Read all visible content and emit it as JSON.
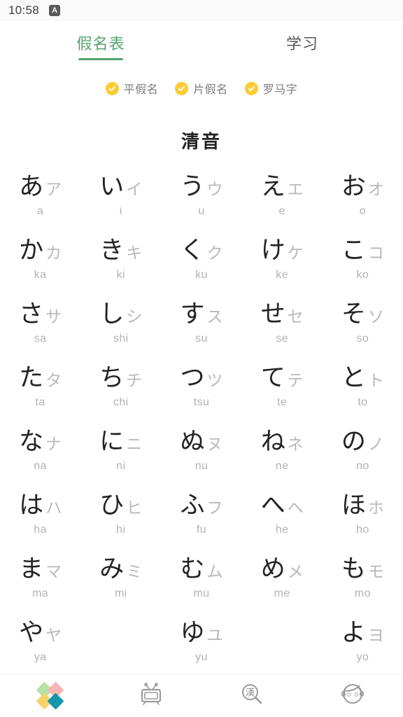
{
  "statusbar": {
    "time": "10:58",
    "ime_badge": "A"
  },
  "tabs": [
    {
      "label": "假名表",
      "active": true,
      "name": "tab-kana-table"
    },
    {
      "label": "学习",
      "active": false,
      "name": "tab-study"
    }
  ],
  "filters": [
    {
      "label": "平假名",
      "checked": true,
      "name": "filter-hiragana"
    },
    {
      "label": "片假名",
      "checked": true,
      "name": "filter-katakana"
    },
    {
      "label": "罗马字",
      "checked": true,
      "name": "filter-romaji"
    }
  ],
  "section": {
    "title": "清音"
  },
  "colors": {
    "accent_green": "#54a36e",
    "check_yellow": "#FCCB33",
    "hiragana": "#232323",
    "katakana": "#b9b9b9",
    "romaji": "#b2b2b2"
  },
  "kana_rows": [
    [
      {
        "hiragana": "あ",
        "katakana": "ア",
        "romaji": "a"
      },
      {
        "hiragana": "い",
        "katakana": "イ",
        "romaji": "i"
      },
      {
        "hiragana": "う",
        "katakana": "ウ",
        "romaji": "u"
      },
      {
        "hiragana": "え",
        "katakana": "エ",
        "romaji": "e"
      },
      {
        "hiragana": "お",
        "katakana": "オ",
        "romaji": "o"
      }
    ],
    [
      {
        "hiragana": "か",
        "katakana": "カ",
        "romaji": "ka"
      },
      {
        "hiragana": "き",
        "katakana": "キ",
        "romaji": "ki"
      },
      {
        "hiragana": "く",
        "katakana": "ク",
        "romaji": "ku"
      },
      {
        "hiragana": "け",
        "katakana": "ケ",
        "romaji": "ke"
      },
      {
        "hiragana": "こ",
        "katakana": "コ",
        "romaji": "ko"
      }
    ],
    [
      {
        "hiragana": "さ",
        "katakana": "サ",
        "romaji": "sa"
      },
      {
        "hiragana": "し",
        "katakana": "シ",
        "romaji": "shi"
      },
      {
        "hiragana": "す",
        "katakana": "ス",
        "romaji": "su"
      },
      {
        "hiragana": "せ",
        "katakana": "セ",
        "romaji": "se"
      },
      {
        "hiragana": "そ",
        "katakana": "ソ",
        "romaji": "so"
      }
    ],
    [
      {
        "hiragana": "た",
        "katakana": "タ",
        "romaji": "ta"
      },
      {
        "hiragana": "ち",
        "katakana": "チ",
        "romaji": "chi"
      },
      {
        "hiragana": "つ",
        "katakana": "ツ",
        "romaji": "tsu"
      },
      {
        "hiragana": "て",
        "katakana": "テ",
        "romaji": "te"
      },
      {
        "hiragana": "と",
        "katakana": "ト",
        "romaji": "to"
      }
    ],
    [
      {
        "hiragana": "な",
        "katakana": "ナ",
        "romaji": "na"
      },
      {
        "hiragana": "に",
        "katakana": "ニ",
        "romaji": "ni"
      },
      {
        "hiragana": "ぬ",
        "katakana": "ヌ",
        "romaji": "nu"
      },
      {
        "hiragana": "ね",
        "katakana": "ネ",
        "romaji": "ne"
      },
      {
        "hiragana": "の",
        "katakana": "ノ",
        "romaji": "no"
      }
    ],
    [
      {
        "hiragana": "は",
        "katakana": "ハ",
        "romaji": "ha"
      },
      {
        "hiragana": "ひ",
        "katakana": "ヒ",
        "romaji": "hi"
      },
      {
        "hiragana": "ふ",
        "katakana": "フ",
        "romaji": "fu"
      },
      {
        "hiragana": "へ",
        "katakana": "ヘ",
        "romaji": "he"
      },
      {
        "hiragana": "ほ",
        "katakana": "ホ",
        "romaji": "ho"
      }
    ],
    [
      {
        "hiragana": "ま",
        "katakana": "マ",
        "romaji": "ma"
      },
      {
        "hiragana": "み",
        "katakana": "ミ",
        "romaji": "mi"
      },
      {
        "hiragana": "む",
        "katakana": "ム",
        "romaji": "mu"
      },
      {
        "hiragana": "め",
        "katakana": "メ",
        "romaji": "me"
      },
      {
        "hiragana": "も",
        "katakana": "モ",
        "romaji": "mo"
      }
    ],
    [
      {
        "hiragana": "や",
        "katakana": "ヤ",
        "romaji": "ya"
      },
      {
        "hiragana": "",
        "katakana": "",
        "romaji": ""
      },
      {
        "hiragana": "ゆ",
        "katakana": "ユ",
        "romaji": "yu"
      },
      {
        "hiragana": "",
        "katakana": "",
        "romaji": ""
      },
      {
        "hiragana": "よ",
        "katakana": "ヨ",
        "romaji": "yo"
      }
    ]
  ],
  "bottom_nav": [
    {
      "icon": "diamonds-icon",
      "name": "nav-kana"
    },
    {
      "icon": "tv-icon",
      "name": "nav-video"
    },
    {
      "icon": "kanji-search-icon",
      "name": "nav-kanji-search"
    },
    {
      "icon": "face-icon",
      "name": "nav-profile"
    }
  ]
}
